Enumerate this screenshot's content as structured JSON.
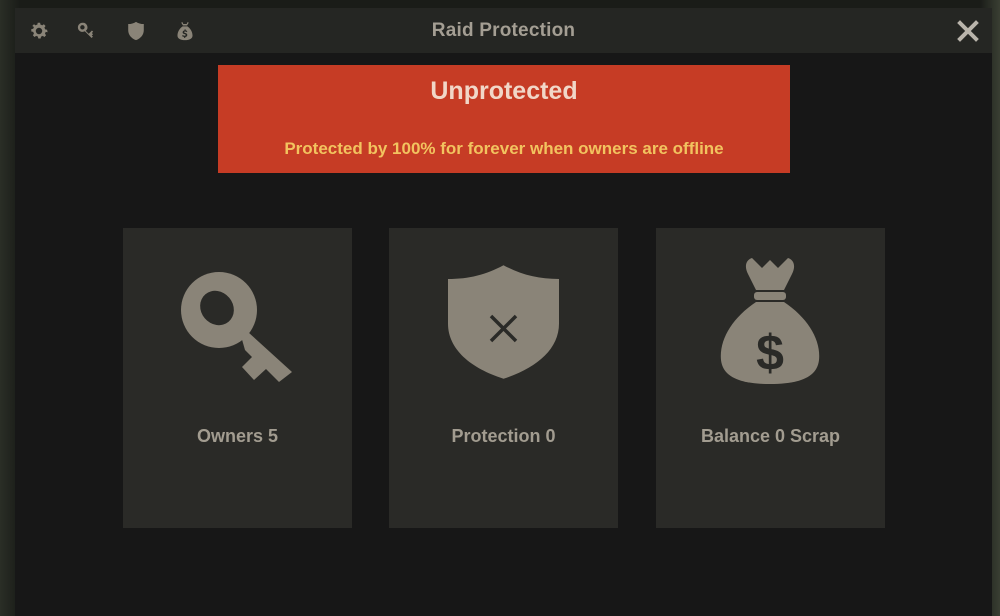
{
  "window": {
    "title": "Raid Protection"
  },
  "toolbar": {
    "icons": [
      "gear-icon",
      "key-icon",
      "shield-icon",
      "money-bag-icon"
    ],
    "close_icon": "close-icon"
  },
  "status": {
    "label": "Unprotected",
    "detail": "Protected by 100% for forever when owners are offline",
    "color": "#c63c25"
  },
  "cards": [
    {
      "icon": "key-icon",
      "label": "Owners 5"
    },
    {
      "icon": "shield-x-icon",
      "label": "Protection 0"
    },
    {
      "icon": "money-bag-icon",
      "label": "Balance 0 Scrap"
    }
  ],
  "colors": {
    "window_bg": "#171717",
    "titlebar_bg": "#252623",
    "card_bg": "#2a2a27",
    "icon": "#8a8478",
    "status_text": "#f1d7c8",
    "detail_text": "#f2c35f"
  }
}
